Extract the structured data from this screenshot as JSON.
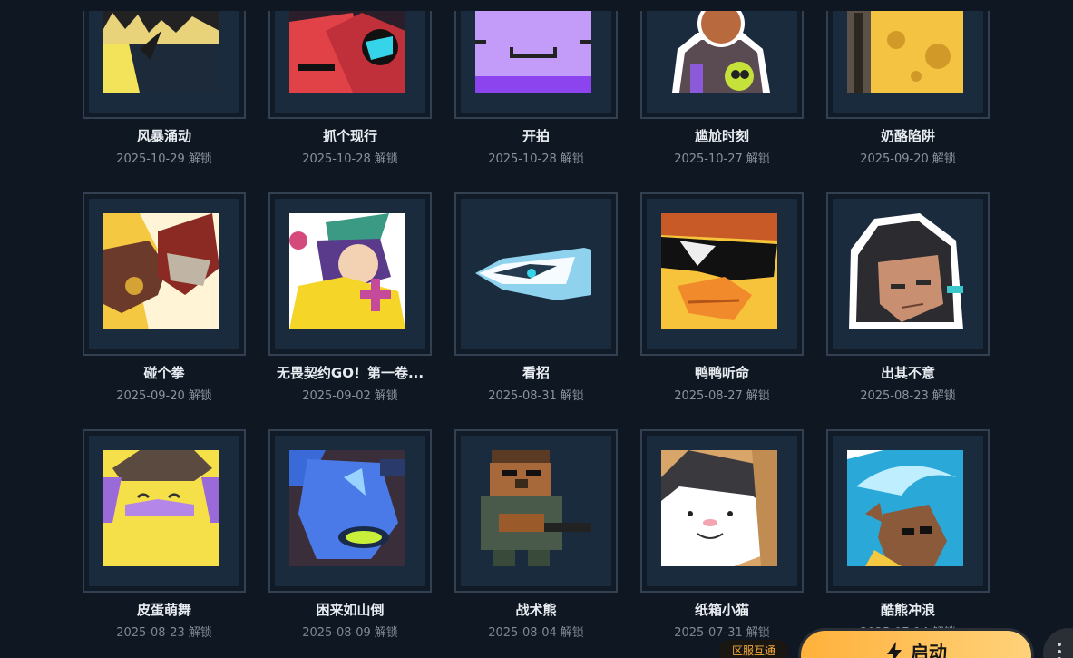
{
  "unlock_suffix": "解锁",
  "rows": [
    [
      {
        "name": "风暴涌动",
        "date": "2025-10-29",
        "icon": "storm-surge-icon"
      },
      {
        "name": "抓个现行",
        "date": "2025-10-28",
        "icon": "caught-red-handed-icon"
      },
      {
        "name": "开拍",
        "date": "2025-10-28",
        "icon": "purple-face-icon"
      },
      {
        "name": "尴尬时刻",
        "date": "2025-10-27",
        "icon": "awkward-kid-icon"
      },
      {
        "name": "奶酪陷阱",
        "date": "2025-09-20",
        "icon": "cheese-trap-icon"
      }
    ],
    [
      {
        "name": "碰个拳",
        "date": "2025-09-20",
        "icon": "fist-bump-icon"
      },
      {
        "name": "无畏契约GO！第一卷...",
        "date": "2025-09-02",
        "icon": "healer-girl-icon"
      },
      {
        "name": "看招",
        "date": "2025-08-31",
        "icon": "blade-icon"
      },
      {
        "name": "鸭鸭听命",
        "date": "2025-08-27",
        "icon": "duck-sunglasses-icon"
      },
      {
        "name": "出其不意",
        "date": "2025-08-23",
        "icon": "surprise-agent-icon"
      }
    ],
    [
      {
        "name": "皮蛋萌舞",
        "date": "2025-08-23",
        "icon": "dancing-egg-icon"
      },
      {
        "name": "困来如山倒",
        "date": "2025-08-09",
        "icon": "sleepy-bot-icon"
      },
      {
        "name": "战术熊",
        "date": "2025-08-04",
        "icon": "tactical-bear-icon"
      },
      {
        "name": "纸箱小猫",
        "date": "2025-07-31",
        "icon": "box-cat-icon"
      },
      {
        "name": "酷熊冲浪",
        "date": "2025-07-14",
        "icon": "surfing-bear-icon"
      }
    ]
  ],
  "footer": {
    "server_tag": "区服互通",
    "launch_label": "启动"
  },
  "colors": {
    "background": "#0f1822",
    "frame_border": "#334052",
    "frame_inner": "#1b2b3e",
    "accent": "#ffb13b"
  }
}
